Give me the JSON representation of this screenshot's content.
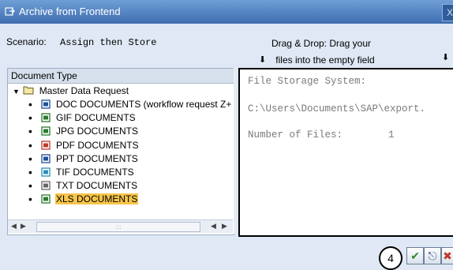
{
  "window": {
    "title": "Archive from Frontend",
    "close_glyph": "X"
  },
  "scenario": {
    "label": "Scenario:",
    "value": "Assign then Store"
  },
  "dragdrop": {
    "line1": "Drag & Drop: Drag your",
    "line2": "files into the empty field"
  },
  "tree": {
    "header": "Document Type",
    "root": "Master Data Request",
    "items": [
      {
        "label": "DOC DOCUMENTS (workflow request Z+",
        "icon": "doc-icon",
        "color": "#1f4f9a"
      },
      {
        "label": "GIF  DOCUMENTS",
        "icon": "gif-icon",
        "color": "#2d7a2d"
      },
      {
        "label": "JPG DOCUMENTS",
        "icon": "jpg-icon",
        "color": "#2d7a2d"
      },
      {
        "label": "PDF  DOCUMENTS",
        "icon": "pdf-icon",
        "color": "#c0392b"
      },
      {
        "label": "PPT  DOCUMENTS",
        "icon": "ppt-icon",
        "color": "#1f4f9a"
      },
      {
        "label": "TIF   DOCUMENTS",
        "icon": "tif-icon",
        "color": "#2a8fb8"
      },
      {
        "label": "TXT  DOCUMENTS",
        "icon": "txt-icon",
        "color": "#666666"
      },
      {
        "label": "XLS  DOCUMENTS",
        "icon": "xls-icon",
        "color": "#2d7a2d",
        "selected": true
      }
    ]
  },
  "drop_area": {
    "storage_label": "File Storage System:",
    "path": "C:\\Users\\Documents\\SAP\\export.",
    "files_label": "Number of Files:",
    "files_count": "1"
  },
  "annotation_number": "4",
  "buttons": {
    "ok": "✔",
    "save": "⎋",
    "cancel": "✖"
  }
}
